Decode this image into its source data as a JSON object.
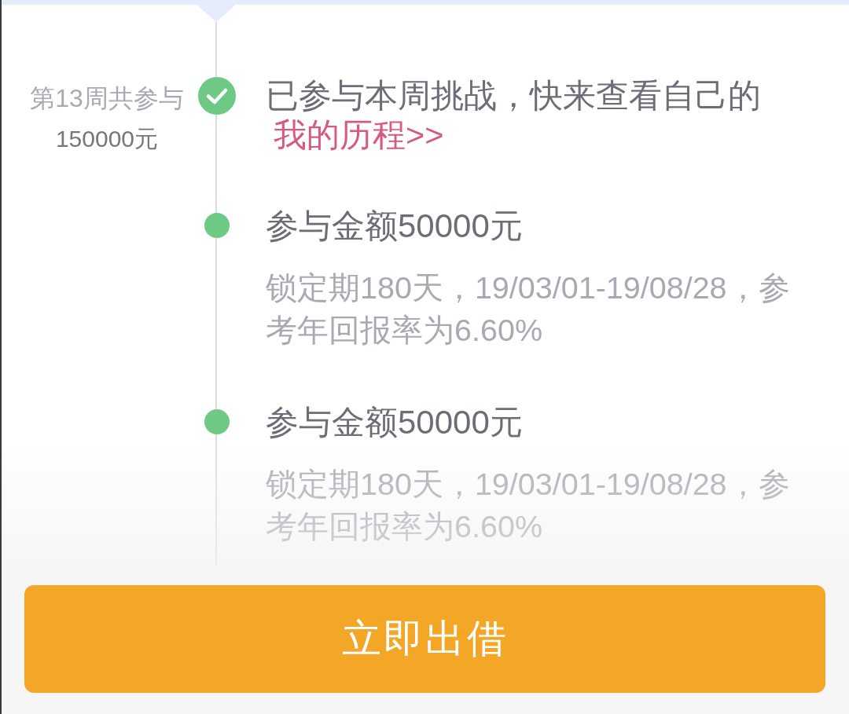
{
  "timeline": {
    "items": [
      {
        "kind": "status",
        "summary": {
          "label": "第13周共参与",
          "amount": "150000元"
        },
        "text": "已参与本周挑战，快来查看自己的",
        "link": "我的历程>>"
      },
      {
        "kind": "record",
        "title": "参与金额50000元",
        "detail": "锁定期180天，19/03/01-19/08/28，参考年回报率为6.60%"
      },
      {
        "kind": "record",
        "title": "参与金额50000元",
        "detail": "锁定期180天，19/03/01-19/08/28，参考年回报率为6.60%"
      }
    ]
  },
  "action_button": {
    "label": "立即出借"
  }
}
